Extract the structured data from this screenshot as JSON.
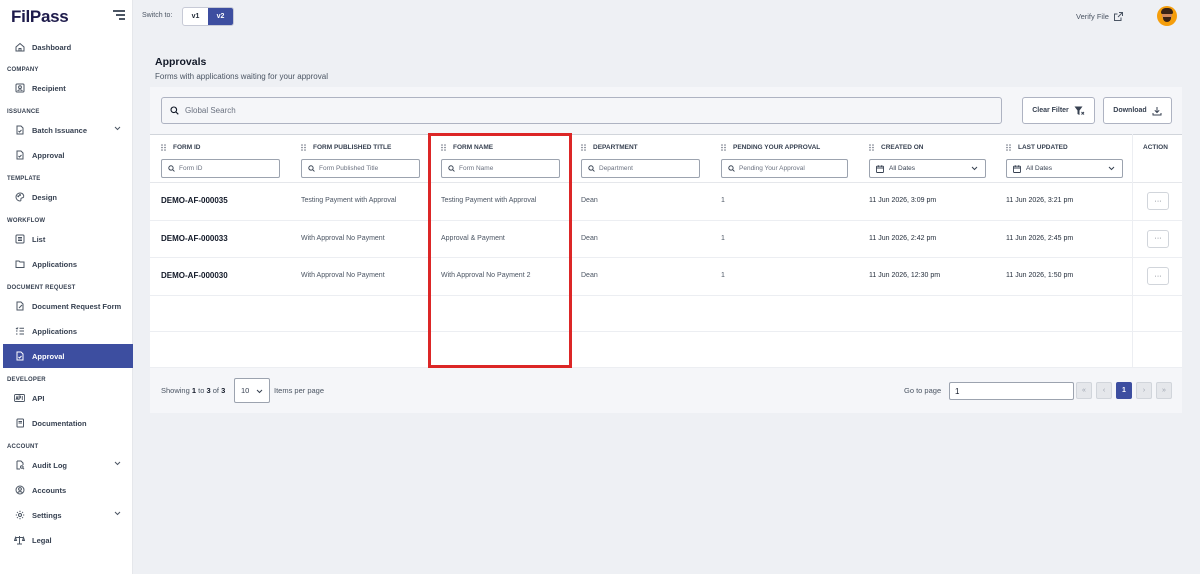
{
  "brand": {
    "name": "FilPass"
  },
  "sidebar": {
    "items": [
      {
        "label": "Dashboard"
      },
      {
        "label": "Recipient"
      },
      {
        "label": "Batch Issuance"
      },
      {
        "label": "Approval"
      },
      {
        "label": "Design"
      },
      {
        "label": "List"
      },
      {
        "label": "Applications"
      },
      {
        "label": "Document Request Form"
      },
      {
        "label": "Applications"
      },
      {
        "label": "Approval"
      },
      {
        "label": "API"
      },
      {
        "label": "Documentation"
      },
      {
        "label": "Audit Log"
      },
      {
        "label": "Accounts"
      },
      {
        "label": "Settings"
      },
      {
        "label": "Legal"
      }
    ],
    "sections": {
      "company": "COMPANY",
      "issuance": "ISSUANCE",
      "template": "TEMPLATE",
      "workflow": "WORKFLOW",
      "document_request": "DOCUMENT REQUEST",
      "developer": "DEVELOPER",
      "account": "ACCOUNT"
    }
  },
  "topbar": {
    "switch_label": "Switch to:",
    "v1": "v1",
    "v2": "v2",
    "verify_file": "Verify File"
  },
  "page": {
    "title": "Approvals",
    "subtitle": "Forms with applications waiting for your approval"
  },
  "toolbar": {
    "search_placeholder": "Global Search",
    "clear_filter": "Clear Filter",
    "download": "Download"
  },
  "table": {
    "columns": [
      {
        "label": "FORM ID",
        "filter": "Form ID"
      },
      {
        "label": "FORM PUBLISHED TITLE",
        "filter": "Form Published Title"
      },
      {
        "label": "FORM NAME",
        "filter": "Form Name"
      },
      {
        "label": "DEPARTMENT",
        "filter": "Department"
      },
      {
        "label": "PENDING YOUR APPROVAL",
        "filter": "Pending Your Approval"
      },
      {
        "label": "CREATED ON",
        "filter": "All Dates"
      },
      {
        "label": "LAST UPDATED",
        "filter": "All Dates"
      },
      {
        "label": "ACTION"
      }
    ],
    "rows": [
      {
        "form_id": "DEMO-AF-000035",
        "published_title": "Testing Payment with Approval",
        "form_name": "Testing Payment with Approval",
        "department": "Dean",
        "pending": "1",
        "created": "11 Jun 2026, 3:09 pm",
        "updated": "11 Jun 2026, 3:21 pm",
        "action": "···"
      },
      {
        "form_id": "DEMO-AF-000033",
        "published_title": "With Approval No Payment",
        "form_name": "Approval & Payment",
        "department": "Dean",
        "pending": "1",
        "created": "11 Jun 2026, 2:42 pm",
        "updated": "11 Jun 2026, 2:45 pm",
        "action": "···"
      },
      {
        "form_id": "DEMO-AF-000030",
        "published_title": "With Approval No Payment",
        "form_name": "With Approval No Payment 2",
        "department": "Dean",
        "pending": "1",
        "created": "11 Jun 2026, 12:30 pm",
        "updated": "11 Jun 2026, 1:50 pm",
        "action": "···"
      }
    ]
  },
  "footer": {
    "showing_prefix": "Showing",
    "from": "1",
    "to_word": "to",
    "to": "3",
    "of_word": "of",
    "total": "3",
    "per_page": "10",
    "per_page_label": "Items per page",
    "goto_label": "Go to page",
    "goto_value": "1",
    "first": "«",
    "prev": "‹",
    "current_page": "1",
    "next": "›",
    "last": "»"
  },
  "colors": {
    "accent": "#3d4ea0",
    "highlight": "#dc2626"
  }
}
